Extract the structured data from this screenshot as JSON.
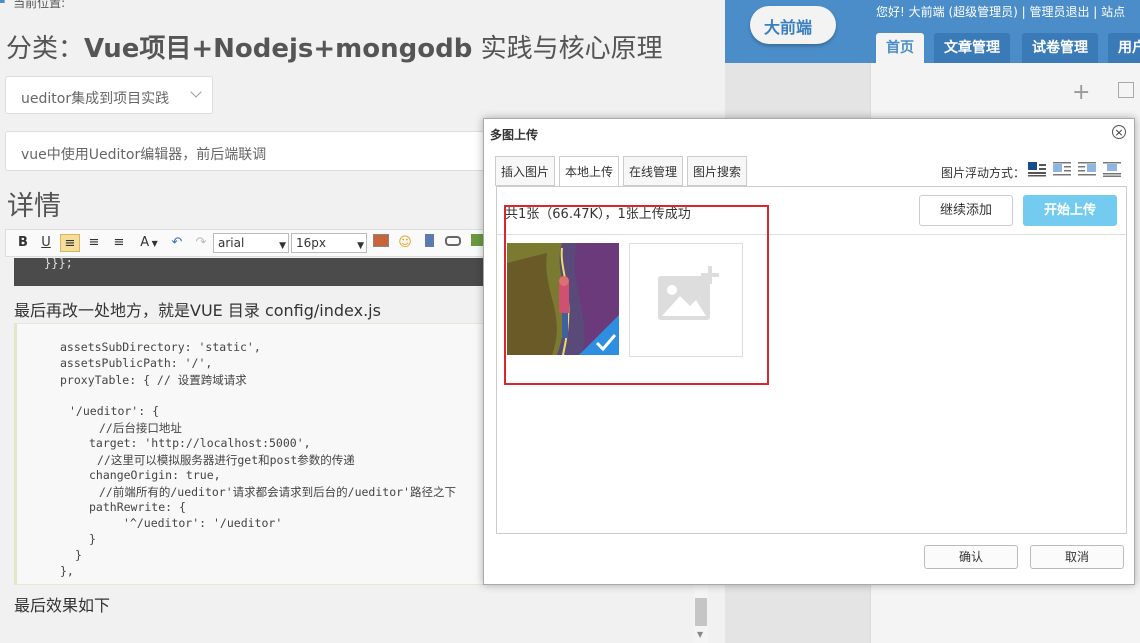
{
  "left_page": {
    "breadcrumb": "当前位置:",
    "title_prefix": "分类：",
    "title_main": "Vue项目+Nodejs+mongodb",
    "title_suffix": " 实践与核心原理",
    "category_select": "ueditor集成到项目实践",
    "article_title": "vue中使用Ueditor编辑器，前后端联调",
    "detail_label": "详情",
    "toolbar": {
      "bold": "B",
      "underline": "U",
      "font_color": "A",
      "font_family": "arial",
      "font_size": "16px"
    },
    "code_tail": "}}};",
    "para_1": "最后再改一处地方，就是VUE 目录 config/index.js",
    "code_lines": [
      "assetsSubDirectory: 'static',",
      "assetsPublicPath: '/',",
      "proxyTable: { // 设置跨域请求",
      "'/ueditor': {",
      "//后台接口地址",
      "target: 'http://localhost:5000',",
      "//这里可以模拟服务器进行get和post参数的传递",
      "changeOrigin: true,",
      "//前端所有的/ueditor'请求都会请求到后台的/ueditor'路径之下",
      "pathRewrite: {",
      "'^/ueditor': '/ueditor'",
      "}",
      "}",
      "},"
    ],
    "para_2": "最后效果如下"
  },
  "header": {
    "logo": "大前端",
    "welcome": "您好! 大前端 (超级管理员) | 管理员退出 | 站点",
    "nav": [
      "首页",
      "文章管理",
      "试卷管理",
      "用户"
    ]
  },
  "dialog": {
    "title": "多图上传",
    "close": "×",
    "tabs": [
      "插入图片",
      "本地上传",
      "在线管理",
      "图片搜索"
    ],
    "float_label": "图片浮动方式：",
    "count_text": "共1张（66.47K），1张上传成功",
    "continue_button": "继续添加",
    "start_button": "开始上传",
    "ok_button": "确认",
    "cancel_button": "取消"
  },
  "colors": {
    "header_blue": "#4b8dc8",
    "start_button": "#73cbef",
    "highlight_red": "#d9272f"
  }
}
